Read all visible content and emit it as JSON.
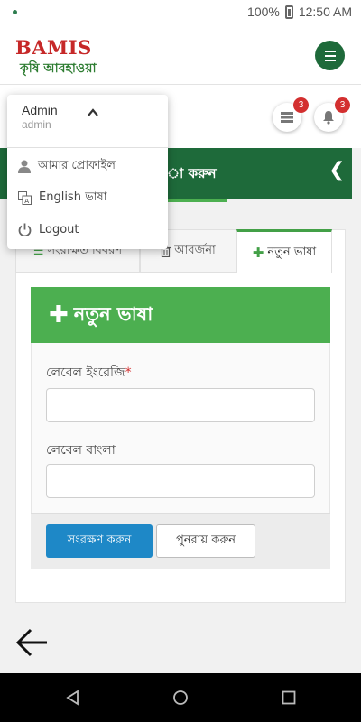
{
  "status_bar": {
    "battery_percent": "100%",
    "time": "12:50 AM"
  },
  "header": {
    "logo_en": "BAMIS",
    "logo_bn": "কৃষি আবহাওয়া",
    "menu_icon": "hamburger-icon"
  },
  "notifications": {
    "messages_count": "3",
    "alerts_count": "3"
  },
  "page_bar": {
    "title": "া করুন",
    "back_icon": "chevron-left-icon"
  },
  "tabs": [
    {
      "label": "সংরক্ষিত বিবরণ",
      "icon": "list-icon"
    },
    {
      "label": "আবর্জনা",
      "icon": "trash-icon"
    },
    {
      "label": "নতুন ভাষা",
      "icon": "plus-icon"
    }
  ],
  "form": {
    "title": "নতুন ভাষা",
    "field_english_label": "লেবেল ইংরেজি",
    "field_english_required": "*",
    "field_english_value": "",
    "field_bangla_label": "লেবেল বাংলা",
    "field_bangla_value": "",
    "save_label": "সংরক্ষণ করুন",
    "reset_label": "পুনরায় করুন"
  },
  "user_menu": {
    "name": "Admin",
    "username": "admin",
    "items": [
      {
        "label": "আমার প্রোফাইল",
        "icon": "user-icon"
      },
      {
        "label": "English ভাষা",
        "icon": "translate-icon"
      },
      {
        "label": "Logout",
        "icon": "power-icon"
      }
    ]
  },
  "colors": {
    "primary_green": "#1e6a3a",
    "accent_green": "#4caf50",
    "brand_red": "#c62828",
    "button_blue": "#1e88c7",
    "badge_red": "#d32f2f"
  }
}
